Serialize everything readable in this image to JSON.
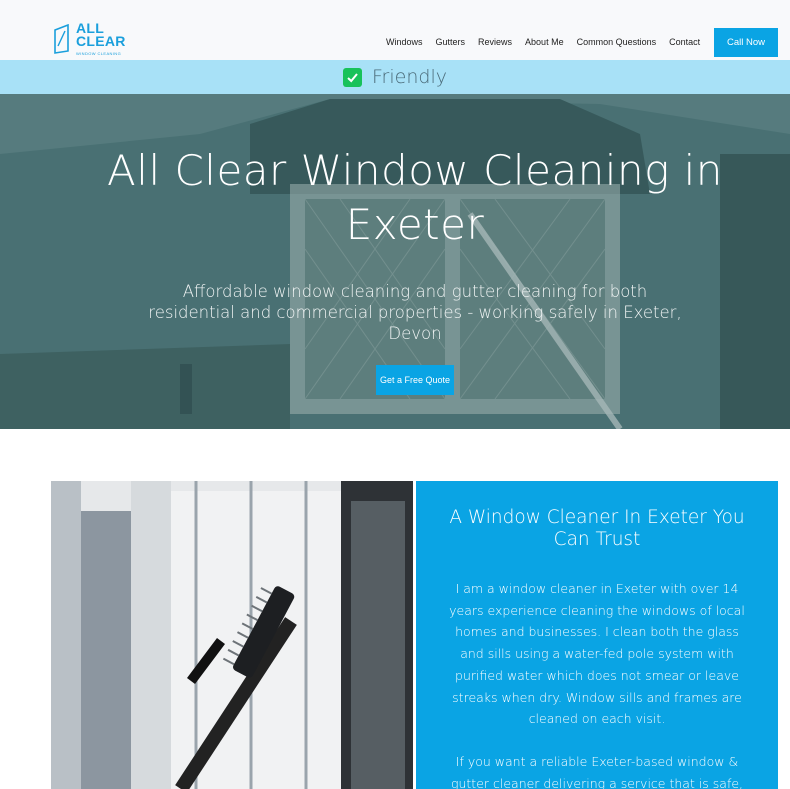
{
  "brand": {
    "logo_line1": "ALL",
    "logo_line2": "CLEAR",
    "logo_sub": "WINDOW CLEANING",
    "accent": "#0aa4e4"
  },
  "nav": {
    "items": [
      "Windows",
      "Gutters",
      "Reviews",
      "About Me",
      "Common Questions",
      "Contact"
    ],
    "cta": "Call Now"
  },
  "banner": {
    "text": "Friendly",
    "icon": "check-icon"
  },
  "hero": {
    "title": "All Clear Window Cleaning in Exeter",
    "subtitle": "Affordable window cleaning and gutter cleaning for both residential and commercial properties - working safely in Exeter, Devon",
    "cta": "Get a Free Quote"
  },
  "intro": {
    "title": "A Window Cleaner In Exeter You Can Trust",
    "para1": "I am a window cleaner in Exeter with over 14 years experience cleaning the windows of local homes and businesses. I clean both the glass and sills using a water-fed pole system with purified water which does not smear or leave streaks when dry. Window sills and frames are cleaned on each visit.",
    "para2": "If you want a reliable Exeter-based window & gutter cleaner delivering a service that is safe,"
  }
}
